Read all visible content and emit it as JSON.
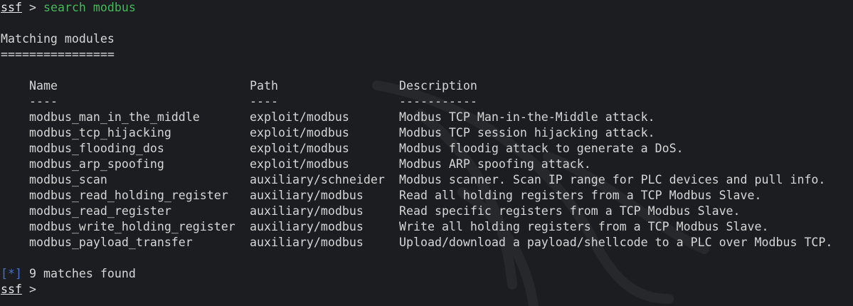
{
  "prompt": {
    "name": "ssf",
    "separator": ">",
    "command": "search modbus"
  },
  "section": {
    "title": "Matching modules",
    "underline": "================"
  },
  "table": {
    "headers": {
      "name": "Name",
      "path": "Path",
      "description": "Description"
    },
    "rules": {
      "name": "----",
      "path": "----",
      "description": "-----------"
    },
    "rows": [
      {
        "name": "modbus_man_in_the_middle",
        "path": "exploit/modbus",
        "description": "Modbus TCP Man-in-the-Middle attack."
      },
      {
        "name": "modbus_tcp_hijacking",
        "path": "exploit/modbus",
        "description": "Modbus TCP session hijacking attack."
      },
      {
        "name": "modbus_flooding_dos",
        "path": "exploit/modbus",
        "description": "Modbus floodig attack to generate a DoS."
      },
      {
        "name": "modbus_arp_spoofing",
        "path": "exploit/modbus",
        "description": "Modbus ARP spoofing attack."
      },
      {
        "name": "modbus_scan",
        "path": "auxiliary/schneider",
        "description": "Modbus scanner. Scan IP range for PLC devices and pull info."
      },
      {
        "name": "modbus_read_holding_register",
        "path": "auxiliary/modbus",
        "description": "Read all holding registers from a TCP Modbus Slave."
      },
      {
        "name": "modbus_read_register",
        "path": "auxiliary/modbus",
        "description": "Read specific registers from a TCP Modbus Slave."
      },
      {
        "name": "modbus_write_holding_register",
        "path": "auxiliary/modbus",
        "description": "Write all holding registers from a TCP Modbus Slave."
      },
      {
        "name": "modbus_payload_transfer",
        "path": "auxiliary/modbus",
        "description": "Upload/download a payload/shellcode to a PLC over Modbus TCP."
      }
    ]
  },
  "result": {
    "tag": "[*]",
    "text": "9 matches found"
  },
  "final_prompt": {
    "name": "ssf",
    "separator": ">"
  },
  "colors": {
    "background": "#1b1d20",
    "text": "#d6d6d6",
    "command": "#46b85a",
    "info_tag": "#4a6fd1"
  },
  "icons": {
    "watermark": "dragon-logo-watermark"
  }
}
